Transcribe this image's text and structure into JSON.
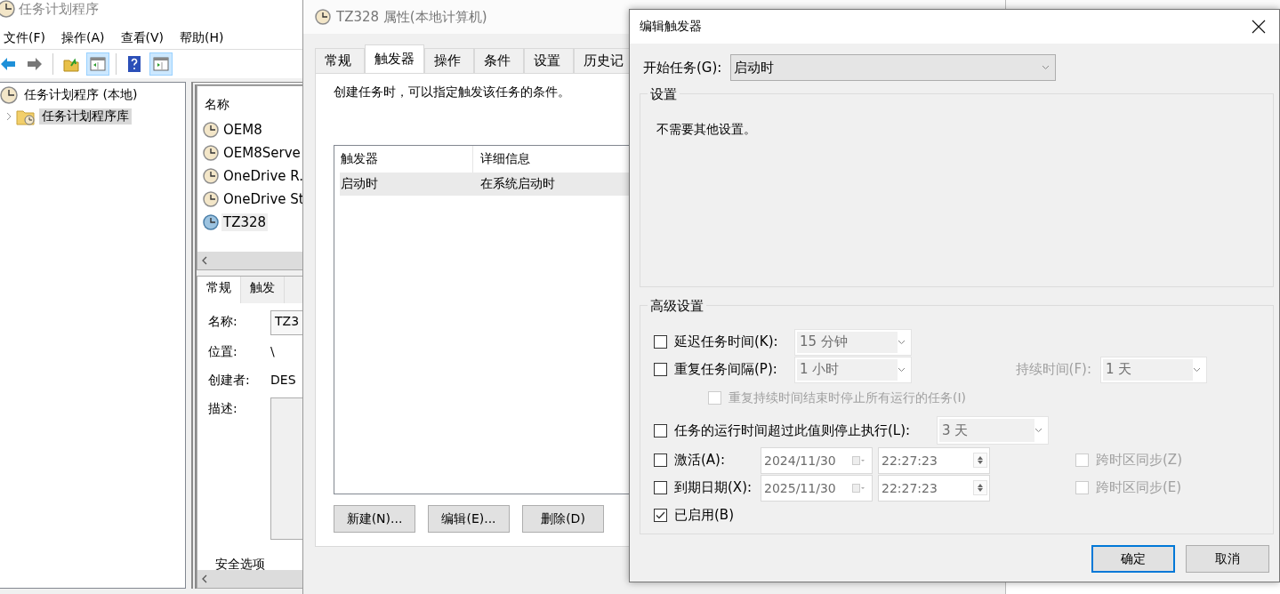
{
  "scheduler": {
    "title": "任务计划程序",
    "menu": [
      "文件(F)",
      "操作(A)",
      "查看(V)",
      "帮助(H)"
    ],
    "toolbar": [
      {
        "kind": "back",
        "on": false
      },
      {
        "kind": "forward",
        "on": false
      },
      {
        "kind": "up",
        "on": false
      },
      {
        "kind": "console-tree",
        "on": true
      },
      {
        "kind": "help",
        "on": false
      },
      {
        "kind": "action-pane",
        "on": true
      }
    ],
    "tree": [
      {
        "label": "任务计划程序 (本地)",
        "selected": false,
        "children": [
          {
            "label": "任务计划程序库",
            "selected": true,
            "expanded": false
          }
        ]
      }
    ],
    "task_list": {
      "column": "名称",
      "rows": [
        {
          "name": "OEM8",
          "selected": false
        },
        {
          "name": "OEM8Serve",
          "selected": false
        },
        {
          "name": "OneDrive R.",
          "selected": false
        },
        {
          "name": "OneDrive St",
          "selected": false
        },
        {
          "name": "TZ328",
          "selected": true
        }
      ]
    },
    "detail_tabs": [
      {
        "label": "常规",
        "selected": true
      },
      {
        "label": "触发",
        "selected": false
      }
    ],
    "details": [
      {
        "label": "名称:",
        "value": "TZ3",
        "kind": "field"
      },
      {
        "label": "位置:",
        "value": "\\",
        "kind": "text"
      },
      {
        "label": "创建者:",
        "value": "DES",
        "kind": "text"
      },
      {
        "label": "描述:",
        "kind": "area"
      }
    ],
    "security_label": "安全选项"
  },
  "properties": {
    "title": "TZ328 属性(本地计算机)",
    "tabs": [
      {
        "label": "常规",
        "selected": false
      },
      {
        "label": "触发器",
        "selected": true
      },
      {
        "label": "操作",
        "selected": false
      },
      {
        "label": "条件",
        "selected": false
      },
      {
        "label": "设置",
        "selected": false
      },
      {
        "label": "历史记",
        "selected": false
      }
    ],
    "hint": "创建任务时，可以指定触发该任务的条件。",
    "table": {
      "columns": [
        "触发器",
        "详细信息"
      ],
      "rows": [
        {
          "cells": [
            "启动时",
            "在系统启动时"
          ],
          "selected": true
        }
      ]
    },
    "buttons": [
      "新建(N)...",
      "编辑(E)...",
      "删除(D)"
    ]
  },
  "edit_trigger": {
    "title": "编辑触发器",
    "begin": {
      "label": "开始任务(G):",
      "value": "启动时"
    },
    "settings": {
      "title": "设置",
      "text": "不需要其他设置。"
    },
    "advanced": {
      "title": "高级设置",
      "delay": {
        "label": "延迟任务时间(K):",
        "checked": false,
        "value": "15 分钟"
      },
      "repeat": {
        "label": "重复任务间隔(P):",
        "checked": false,
        "value": "1 小时",
        "duration_label": "持续时间(F):",
        "duration_value": "1 天"
      },
      "stop_at_end": {
        "label": "重复持续时间结束时停止所有运行的任务(I)",
        "checked": false
      },
      "stop_if_longer": {
        "label": "任务的运行时间超过此值则停止执行(L):",
        "checked": false,
        "value": "3 天"
      },
      "activate": {
        "label": "激活(A):",
        "checked": false,
        "date": "2024/11/30",
        "time": "22:27:23",
        "sync_label": "跨时区同步(Z)",
        "sync_checked": false
      },
      "expire": {
        "label": "到期日期(X):",
        "checked": false,
        "date": "2025/11/30",
        "time": "22:27:23",
        "sync_label": "跨时区同步(E)",
        "sync_checked": false
      },
      "enabled": {
        "label": "已启用(B)",
        "checked": true
      }
    },
    "buttons": [
      {
        "label": "确定",
        "default": true
      },
      {
        "label": "取消",
        "default": false
      }
    ]
  }
}
